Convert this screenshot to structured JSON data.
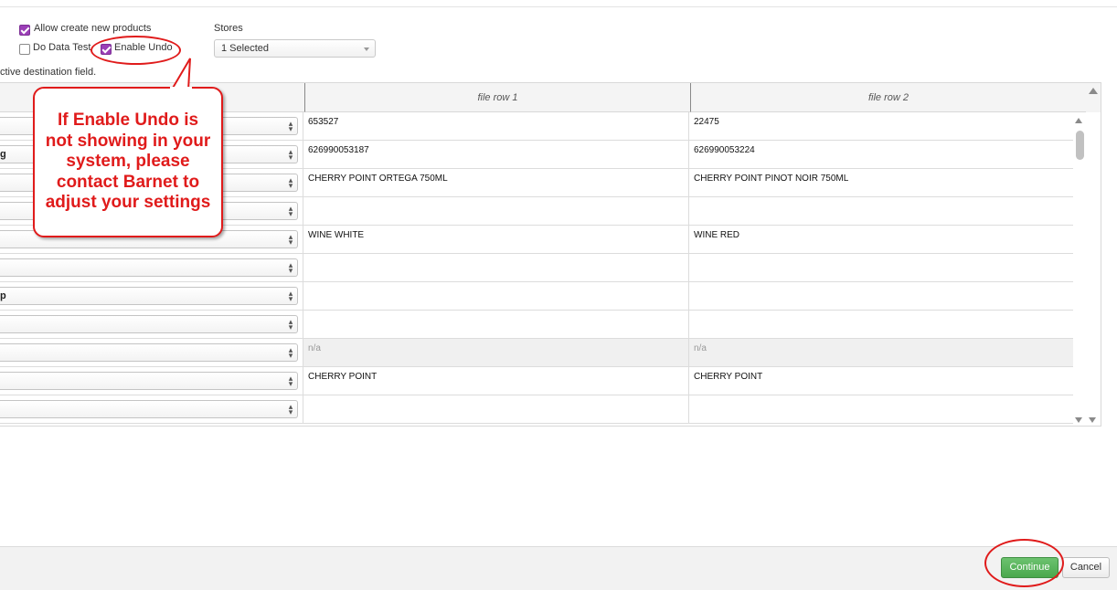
{
  "options": {
    "allow_create_label": "Allow create new products",
    "allow_create_checked": true,
    "data_test_label": "Do Data Test",
    "data_test_checked": false,
    "enable_undo_label": "Enable Undo",
    "enable_undo_checked": true
  },
  "stores": {
    "label": "Stores",
    "selected": "1 Selected"
  },
  "hint_text": "ctive destination field.",
  "grid": {
    "columns": [
      "",
      "file row 1",
      "file row 2"
    ],
    "rows": [
      {
        "field": "",
        "row1": "653527",
        "row2": "22475"
      },
      {
        "field": "g",
        "row1": "626990053187",
        "row2": "626990053224"
      },
      {
        "field": "",
        "row1": "CHERRY POINT ORTEGA 750ML",
        "row2": "CHERRY POINT PINOT NOIR 750ML"
      },
      {
        "field": "",
        "row1": "",
        "row2": ""
      },
      {
        "field": "",
        "row1": "WINE WHITE",
        "row2": "WINE RED"
      },
      {
        "field": "",
        "row1": "",
        "row2": ""
      },
      {
        "field": "p",
        "row1": "",
        "row2": ""
      },
      {
        "field": "",
        "row1": "",
        "row2": ""
      },
      {
        "field": "",
        "row1": "n/a",
        "row2": "n/a"
      },
      {
        "field": "",
        "row1": "CHERRY POINT",
        "row2": "CHERRY POINT"
      },
      {
        "field": "",
        "row1": "",
        "row2": ""
      }
    ]
  },
  "callout": {
    "line1": "If Enable Undo is",
    "line2": "not showing in your",
    "line3": "system, please",
    "line4": "contact Barnet to",
    "line5": "adjust your settings"
  },
  "footer": {
    "continue_label": "Continue",
    "cancel_label": "Cancel"
  },
  "colors": {
    "annotation_red": "#e01b1b",
    "checkbox_purple": "#9b3fb7",
    "continue_green": "#4aa84d"
  }
}
